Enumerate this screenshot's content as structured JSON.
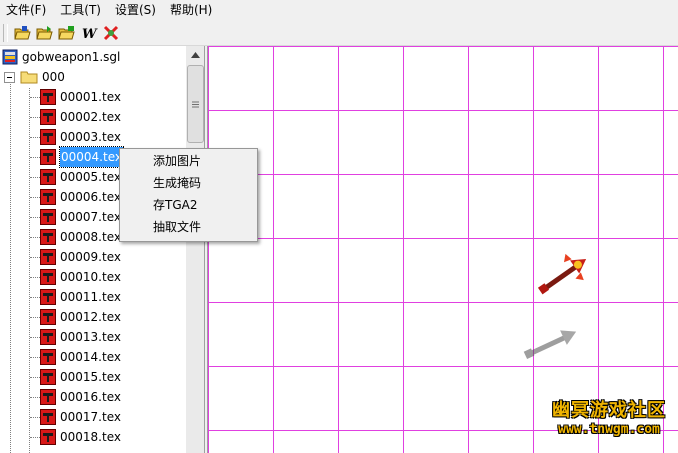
{
  "menubar": {
    "items": [
      "文件(F)",
      "工具(T)",
      "设置(S)",
      "帮助(H)"
    ]
  },
  "toolbar": {
    "buttons": [
      "open-icon",
      "open-folder-icon",
      "save-folder-icon",
      "w-icon",
      "stop-icon"
    ],
    "w_glyph": "W"
  },
  "tree": {
    "root": "gobweapon1.sgl",
    "folder": "000",
    "files": [
      "00001.tex",
      "00002.tex",
      "00003.tex",
      "00004.tex",
      "00005.tex",
      "00006.tex",
      "00007.tex",
      "00008.tex",
      "00009.tex",
      "00010.tex",
      "00011.tex",
      "00012.tex",
      "00013.tex",
      "00014.tex",
      "00015.tex",
      "00016.tex",
      "00017.tex",
      "00018.tex"
    ],
    "selected_index": 3
  },
  "context_menu": {
    "items": [
      "添加图片",
      "生成掩码",
      "存TGA2",
      "抽取文件"
    ]
  },
  "watermark": {
    "title": "幽冥游戏社区",
    "url": "www.tnwgm.com"
  },
  "colors": {
    "grid_line": "#e040e0",
    "selection": "#3399ff",
    "watermark": "#f0b400"
  }
}
